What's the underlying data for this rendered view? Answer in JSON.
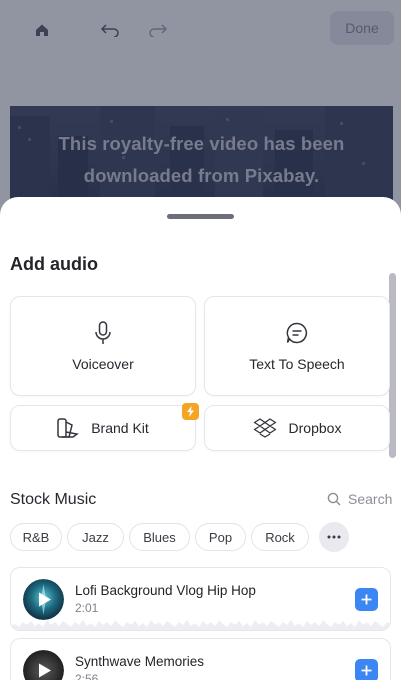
{
  "toolbar": {
    "home_icon": "home-icon",
    "undo_icon": "undo-icon",
    "redo_icon": "redo-icon",
    "done_label": "Done"
  },
  "video": {
    "caption_line1": "This royalty-free video has been",
    "caption_line2": "downloaded from Pixabay."
  },
  "sheet": {
    "title": "Add audio",
    "options": [
      {
        "label": "Voiceover",
        "icon": "microphone-icon"
      },
      {
        "label": "Text To Speech",
        "icon": "speech-bubble-icon"
      },
      {
        "label": "Brand Kit",
        "icon": "brand-kit-icon",
        "badge_icon": "lightning-icon"
      },
      {
        "label": "Dropbox",
        "icon": "dropbox-icon"
      }
    ],
    "stock_music": {
      "title": "Stock Music",
      "search_label": "Search",
      "genres": [
        "R&B",
        "Jazz",
        "Blues",
        "Pop",
        "Rock"
      ],
      "more_icon": "more-dots-icon"
    },
    "tracks": [
      {
        "title": "Lofi Background Vlog Hip Hop",
        "duration": "2:01"
      },
      {
        "title": "Synthwave Memories",
        "duration": "2:56"
      }
    ]
  },
  "colors": {
    "accent": "#3b86f3",
    "badge": "#f5a524"
  }
}
